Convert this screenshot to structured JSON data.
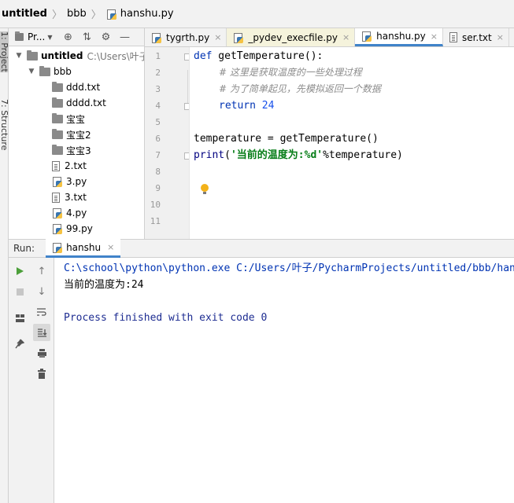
{
  "breadcrumb": {
    "project": "untitled",
    "folder": "bbb",
    "file": "hanshu.py"
  },
  "side_tabs": {
    "project": "1: Project",
    "structure": "7: Structure"
  },
  "project_panel": {
    "title": "Pr...",
    "icons": [
      "globe-icon",
      "collapse-icon",
      "gear-icon",
      "minimize-icon"
    ],
    "tree": [
      {
        "label": "untitled",
        "hint": "C:\\Users\\叶子",
        "kind": "folder",
        "depth": 0,
        "expanded": true
      },
      {
        "label": "bbb",
        "kind": "folder",
        "depth": 1,
        "expanded": true
      },
      {
        "label": "ddd.txt",
        "kind": "folder",
        "depth": 2
      },
      {
        "label": "dddd.txt",
        "kind": "folder",
        "depth": 2
      },
      {
        "label": "宝宝",
        "kind": "folder",
        "depth": 2
      },
      {
        "label": "宝宝2",
        "kind": "folder",
        "depth": 2
      },
      {
        "label": "宝宝3",
        "kind": "folder",
        "depth": 2
      },
      {
        "label": "2.txt",
        "kind": "txt",
        "depth": 2
      },
      {
        "label": "3.py",
        "kind": "py",
        "depth": 2
      },
      {
        "label": "3.txt",
        "kind": "txt",
        "depth": 2
      },
      {
        "label": "4.py",
        "kind": "py",
        "depth": 2
      },
      {
        "label": "99.py",
        "kind": "py",
        "depth": 2
      }
    ]
  },
  "editor_tabs": [
    {
      "label": "tygrth.py",
      "kind": "py",
      "active": false,
      "tint": false
    },
    {
      "label": "_pydev_execfile.py",
      "kind": "py",
      "active": false,
      "tint": true
    },
    {
      "label": "hanshu.py",
      "kind": "py",
      "active": true,
      "tint": false
    },
    {
      "label": "ser.txt",
      "kind": "txt",
      "active": false,
      "tint": false
    }
  ],
  "close_glyph": "×",
  "code": {
    "line_numbers": [
      "1",
      "2",
      "3",
      "4",
      "5",
      "6",
      "7",
      "8",
      "9",
      "10",
      "11"
    ],
    "line1": {
      "kw": "def",
      "rest": " getTemperature():"
    },
    "line2": "# 这里是获取温度的一些处理过程",
    "line3": "# 为了简单起见，先模拟返回一个数据",
    "line4": {
      "kw": "return",
      "num": "24"
    },
    "line6": "temperature = getTemperature()",
    "line7": {
      "builtin": "print",
      "open": "(",
      "str": "'当前的温度为:%d'",
      "rest": "%temperature)"
    }
  },
  "run_panel": {
    "label": "Run:",
    "tab": "hanshu",
    "output": [
      "C:\\school\\python\\python.exe C:/Users/叶子/PycharmProjects/untitled/bbb/hanshu.py",
      "当前的温度为:24",
      "",
      "Process finished with exit code 0"
    ]
  },
  "colors": {
    "keyword": "#0033b3",
    "string": "#067d17",
    "accent": "#4083c9",
    "run_green": "#4c9f3a"
  }
}
